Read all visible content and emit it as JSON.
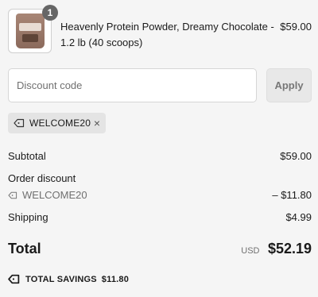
{
  "product": {
    "name": "Heavenly Protein Powder, Dreamy Chocolate - 1.2 lb (40 scoops)",
    "price": "$59.00",
    "quantity": "1"
  },
  "discount": {
    "placeholder": "Discount code",
    "apply_label": "Apply",
    "applied_code": "WELCOME20",
    "remove_icon": "×"
  },
  "summary": {
    "subtotal_label": "Subtotal",
    "subtotal_value": "$59.00",
    "order_discount_label": "Order discount",
    "discount_code": "WELCOME20",
    "discount_value": "– $11.80",
    "shipping_label": "Shipping",
    "shipping_value": "$4.99",
    "total_label": "Total",
    "currency": "USD",
    "total_value": "$52.19",
    "savings_label": "TOTAL SAVINGS",
    "savings_value": "$11.80"
  },
  "icons": {
    "tag": "tag-icon",
    "close": "close-icon"
  }
}
